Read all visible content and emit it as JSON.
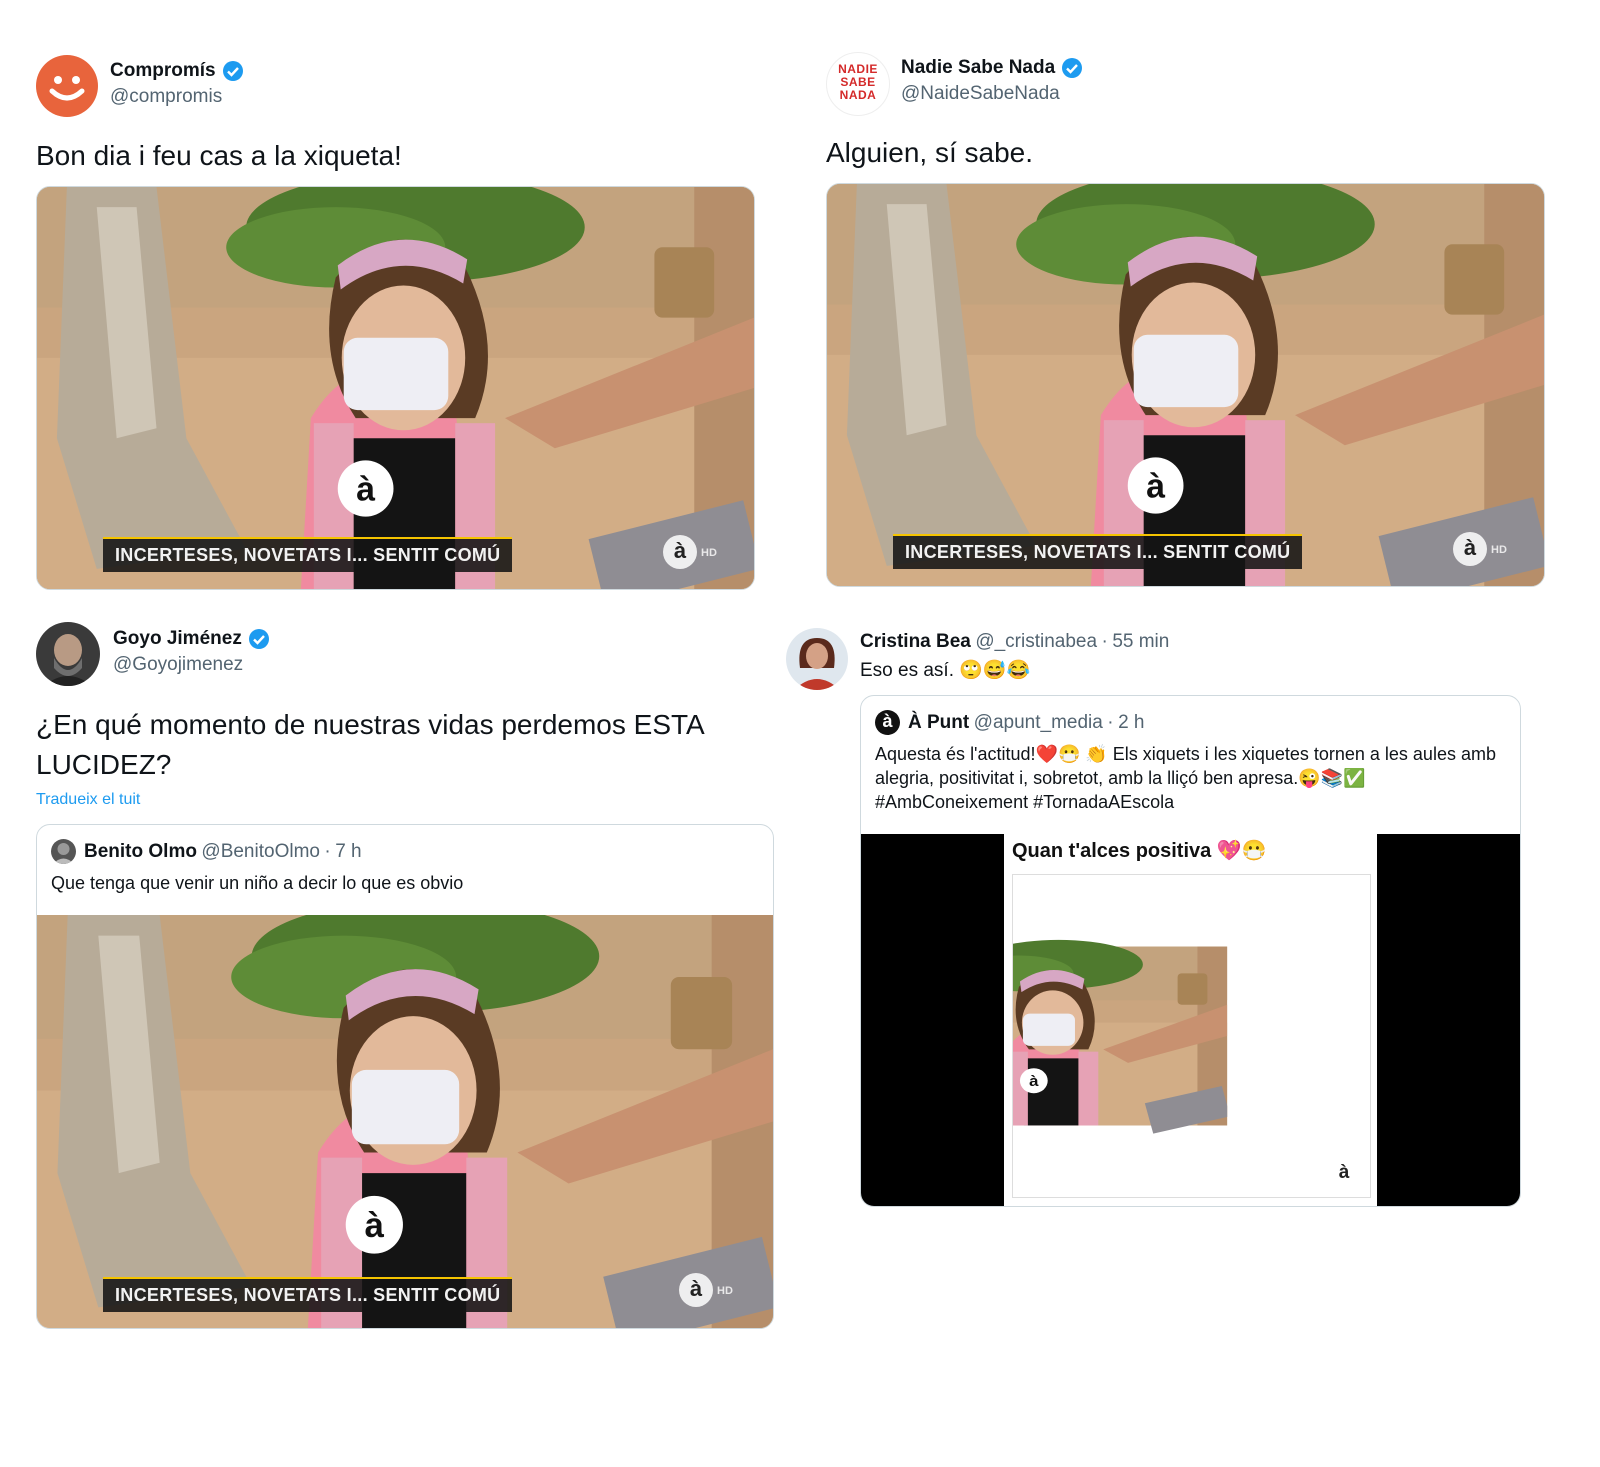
{
  "tweets": {
    "compromis": {
      "name": "Compromís",
      "handle": "@compromis",
      "text": "Bon dia i feu cas a la xiqueta!"
    },
    "nadie": {
      "name": "Nadie Sabe Nada",
      "handle": "@NaideSabeNada",
      "avatar_text": "NADIE SABE NADA",
      "text": "Alguien, sí sabe."
    },
    "goyo": {
      "name": "Goyo Jiménez",
      "handle": "@Goyojimenez",
      "text": "¿En qué momento de nuestras vidas perdemos ESTA LUCIDEZ?",
      "translate": "Tradueix el tuit",
      "quoted": {
        "name": "Benito Olmo",
        "handle": "@BenitoOlmo",
        "time": "7 h",
        "text": "Que tenga que venir un niño a decir lo que es obvio"
      }
    },
    "cristina": {
      "name": "Cristina Bea",
      "handle": "@_cristinabea",
      "time": "55 min",
      "text": "Eso es así. 🙄😅😂",
      "quoted": {
        "name": "À Punt",
        "handle": "@apunt_media",
        "time": "2 h",
        "text": "Aquesta és l'actitud!❤️😷 👏 Els xiquets i les xiquetes tornen a les aules amb alegria, positivitat i, sobretot, amb la lliçó ben apresa.😜📚✅ #AmbConeixement #TornadaAEscola",
        "media_caption": "Quan t'alces positiva 💖😷"
      }
    }
  },
  "video": {
    "caption": "INCERTESES, NOVETATS I... SENTIT COMÚ",
    "logo": "à",
    "hd": "HD"
  },
  "colors": {
    "accent": "#1d9bf0",
    "compromis_orange": "#e8643c",
    "nadie_red": "#d42a2a"
  }
}
